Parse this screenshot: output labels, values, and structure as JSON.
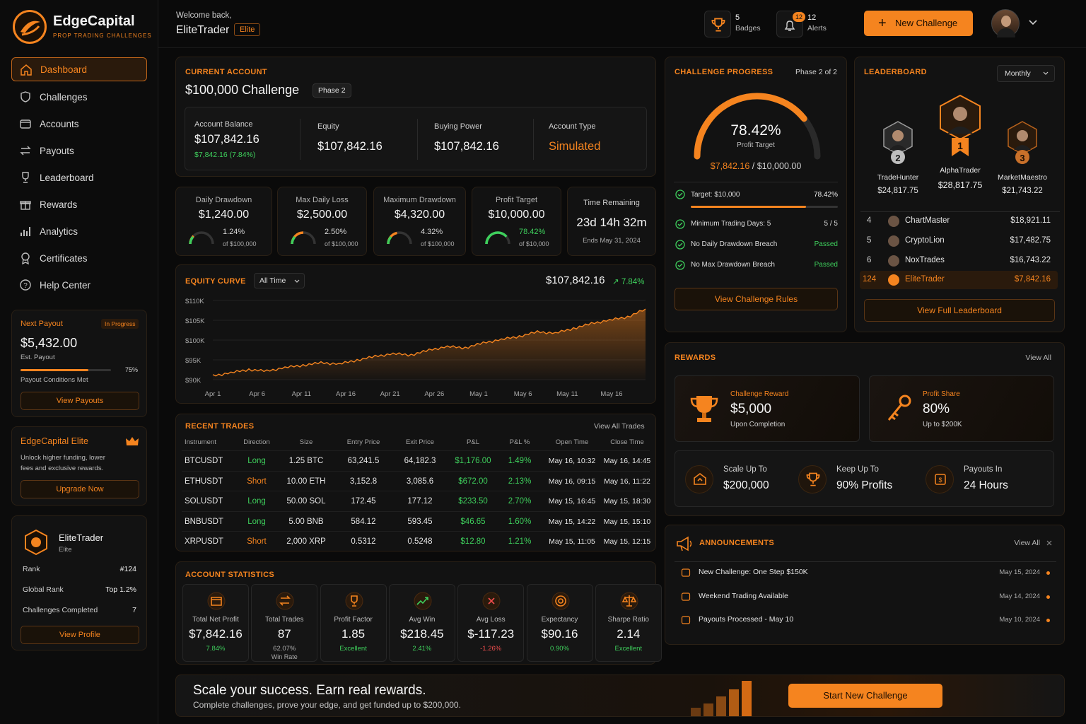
{
  "brand": {
    "name": "EdgeCapital",
    "tagline": "PROP TRADING CHALLENGES"
  },
  "colors": {
    "accent": "#f5841f",
    "positive": "#3ecf5c",
    "negative": "#ef4d4d",
    "background": "#0a0a0a"
  },
  "nav": [
    {
      "label": "Dashboard",
      "icon": "home-icon"
    },
    {
      "label": "Challenges",
      "icon": "shield-icon"
    },
    {
      "label": "Accounts",
      "icon": "wallet-icon"
    },
    {
      "label": "Payouts",
      "icon": "transfer-icon"
    },
    {
      "label": "Leaderboard",
      "icon": "trophy-icon"
    },
    {
      "label": "Rewards",
      "icon": "gift-icon"
    },
    {
      "label": "Analytics",
      "icon": "bars-icon"
    },
    {
      "label": "Certificates",
      "icon": "certificate-icon"
    },
    {
      "label": "Help Center",
      "icon": "help-icon"
    }
  ],
  "next_payout": {
    "title": "Next Payout",
    "status": "In Progress",
    "amount": "$5,432.00",
    "sub": "Est. Payout",
    "progress": 0.75,
    "progress_label": "75%",
    "conditions": "Payout Conditions Met",
    "button": "View Payouts"
  },
  "elite": {
    "title": "EdgeCapital Elite",
    "desc": "Unlock higher funding, lower fees and exclusive rewards.",
    "button": "Upgrade Now"
  },
  "profile": {
    "name": "EliteTrader",
    "tier": "Elite",
    "rows": [
      {
        "label": "Rank",
        "value": "#124"
      },
      {
        "label": "Global Rank",
        "value": "Top 1.2%"
      },
      {
        "label": "Challenges Completed",
        "value": "7"
      }
    ],
    "button": "View Profile"
  },
  "header": {
    "welcome": "Welcome back,",
    "user": "EliteTrader",
    "badge": "Elite",
    "badges_count": "5",
    "badges_label": "Badges",
    "alerts_count": "12",
    "alerts_label": "Alerts",
    "new_challenge": "New Challenge"
  },
  "current_account": {
    "section": "CURRENT ACCOUNT",
    "title": "$100,000 Challenge",
    "phase": "Phase 2",
    "balance_label": "Account Balance",
    "balance": "$107,842.16",
    "balance_change": "$7,842.16 (7.84%)",
    "equity_label": "Equity",
    "equity": "$107,842.16",
    "buying_power_label": "Buying Power",
    "buying_power": "$107,842.16",
    "type_label": "Account Type",
    "type": "Simulated"
  },
  "kpis": [
    {
      "label": "Daily Drawdown",
      "value": "$1,240.00",
      "pct": "1.24%",
      "of": "of $100,000",
      "fill": 0.25
    },
    {
      "label": "Max Daily Loss",
      "value": "$2,500.00",
      "pct": "2.50%",
      "of": "of $100,000",
      "fill": 0.5
    },
    {
      "label": "Maximum Drawdown",
      "value": "$4,320.00",
      "pct": "4.32%",
      "of": "of $100,000",
      "fill": 0.43
    },
    {
      "label": "Profit Target",
      "value": "$10,000.00",
      "pct": "78.42%",
      "of": "of $10,000",
      "fill": 0.78
    }
  ],
  "time_remaining": {
    "label": "Time Remaining",
    "value": "23d 14h 32m",
    "ends": "Ends May 31, 2024"
  },
  "equity": {
    "section": "EQUITY CURVE",
    "range": "All Time",
    "value": "$107,842.16",
    "change": "7.84%",
    "yticks": [
      "$110K",
      "$105K",
      "$100K",
      "$95K",
      "$90K"
    ],
    "xticks": [
      "Apr 1",
      "Apr 6",
      "Apr 11",
      "Apr 16",
      "Apr 21",
      "Apr 26",
      "May 1",
      "May 6",
      "May 11",
      "May 16"
    ]
  },
  "chart_data": {
    "type": "area",
    "title": "EQUITY CURVE",
    "ylim": [
      90000,
      110000
    ],
    "x": [
      "Apr 1",
      "Apr 3",
      "Apr 5",
      "Apr 7",
      "Apr 9",
      "Apr 11",
      "Apr 13",
      "Apr 15",
      "Apr 17",
      "Apr 19",
      "Apr 21",
      "Apr 23",
      "Apr 25",
      "Apr 27",
      "Apr 29",
      "May 1",
      "May 3",
      "May 5",
      "May 7",
      "May 9",
      "May 11",
      "May 13",
      "May 15",
      "May 17",
      "May 19"
    ],
    "values": [
      91000,
      91800,
      92600,
      92200,
      93100,
      93700,
      94300,
      94000,
      95000,
      95900,
      96600,
      96300,
      97500,
      98400,
      98100,
      99300,
      100200,
      101000,
      102100,
      101800,
      103000,
      104200,
      105100,
      105900,
      107842
    ]
  },
  "trades": {
    "section": "RECENT TRADES",
    "view_all": "View All Trades",
    "columns": [
      "Instrument",
      "Direction",
      "Size",
      "Entry Price",
      "Exit Price",
      "P&L",
      "P&L %",
      "Open Time",
      "Close Time"
    ],
    "rows": [
      [
        "BTCUSDT",
        "Long",
        "1.25 BTC",
        "63,241.5",
        "64,182.3",
        "$1,176.00",
        "1.49%",
        "May 16, 10:32",
        "May 16, 14:45"
      ],
      [
        "ETHUSDT",
        "Short",
        "10.00 ETH",
        "3,152.8",
        "3,085.6",
        "$672.00",
        "2.13%",
        "May 16, 09:15",
        "May 16, 11:22"
      ],
      [
        "SOLUSDT",
        "Long",
        "50.00 SOL",
        "172.45",
        "177.12",
        "$233.50",
        "2.70%",
        "May 15, 16:45",
        "May 15, 18:30"
      ],
      [
        "BNBUSDT",
        "Long",
        "5.00 BNB",
        "584.12",
        "593.45",
        "$46.65",
        "1.60%",
        "May 15, 14:22",
        "May 15, 15:10"
      ],
      [
        "XRPUSDT",
        "Short",
        "2,000 XRP",
        "0.5312",
        "0.5248",
        "$12.80",
        "1.21%",
        "May 15, 11:05",
        "May 15, 12:15"
      ]
    ]
  },
  "stats": {
    "section": "ACCOUNT STATISTICS",
    "items": [
      {
        "label": "Total Net Profit",
        "value": "$7,842.16",
        "sub": "7.84%",
        "sub_color": "green",
        "icon": "wallet-icon"
      },
      {
        "label": "Total Trades",
        "value": "87",
        "sub": "62.07%",
        "sub2": "Win Rate",
        "sub_color": "muted",
        "icon": "swap-icon"
      },
      {
        "label": "Profit Factor",
        "value": "1.85",
        "sub": "Excellent",
        "sub_color": "green",
        "icon": "trophy-icon"
      },
      {
        "label": "Avg Win",
        "value": "$218.45",
        "sub": "2.41%",
        "sub_color": "green",
        "icon": "trend-up-icon"
      },
      {
        "label": "Avg Loss",
        "value": "$-117.23",
        "sub": "-1.26%",
        "sub_color": "red",
        "icon": "cross-circle-icon"
      },
      {
        "label": "Expectancy",
        "value": "$90.16",
        "sub": "0.90%",
        "sub_color": "green",
        "icon": "target-icon"
      },
      {
        "label": "Sharpe Ratio",
        "value": "2.14",
        "sub": "Excellent",
        "sub_color": "green",
        "icon": "scale-icon"
      }
    ]
  },
  "progress": {
    "section": "CHALLENGE PROGRESS",
    "phase": "Phase 2 of 2",
    "pct": "78.42%",
    "pct_value": 0.7842,
    "pct_label": "Profit Target",
    "amount": "$7,842.16",
    "target": "/ $10,000.00",
    "target_label": "Target: $10,000",
    "target_pct": "78.42%",
    "checks": [
      {
        "label": "Minimum Trading Days: 5",
        "value": "5 / 5"
      },
      {
        "label": "No Daily Drawdown Breach",
        "value": "Passed"
      },
      {
        "label": "No Max Drawdown Breach",
        "value": "Passed"
      }
    ],
    "button": "View Challenge Rules"
  },
  "leaderboard": {
    "section": "LEADERBOARD",
    "period": "Monthly",
    "podium": [
      {
        "rank": "2",
        "name": "TradeHunter",
        "value": "$24,817.75"
      },
      {
        "rank": "1",
        "name": "AlphaTrader",
        "value": "$28,817.75"
      },
      {
        "rank": "3",
        "name": "MarketMaestro",
        "value": "$21,743.22"
      }
    ],
    "rows": [
      {
        "rank": "4",
        "name": "ChartMaster",
        "value": "$18,921.11"
      },
      {
        "rank": "5",
        "name": "CryptoLion",
        "value": "$17,482.75"
      },
      {
        "rank": "6",
        "name": "NoxTrades",
        "value": "$16,743.22"
      },
      {
        "rank": "124",
        "name": "EliteTrader",
        "value": "$7,842.16"
      }
    ],
    "button": "View Full Leaderboard"
  },
  "rewards": {
    "section": "REWARDS",
    "view_all": "View All",
    "challenge": {
      "label": "Challenge Reward",
      "value": "$5,000",
      "sub": "Upon Completion"
    },
    "share": {
      "label": "Profit Share",
      "value": "80%",
      "sub": "Up to $200K"
    },
    "perks": [
      {
        "label": "Scale Up To",
        "value": "$200,000"
      },
      {
        "label": "Keep Up To",
        "value": "90% Profits"
      },
      {
        "label": "Payouts In",
        "value": "24 Hours"
      }
    ]
  },
  "announcements": {
    "section": "ANNOUNCEMENTS",
    "view_all": "View All",
    "items": [
      {
        "title": "New Challenge: One Step $150K",
        "date": "May 15, 2024"
      },
      {
        "title": "Weekend Trading Available",
        "date": "May 14, 2024"
      },
      {
        "title": "Payouts Processed - May 10",
        "date": "May 10, 2024"
      }
    ]
  },
  "banner": {
    "title": "Scale your success. Earn real rewards.",
    "sub": "Complete challenges, prove your edge, and get funded up to $200,000.",
    "button": "Start New Challenge"
  }
}
